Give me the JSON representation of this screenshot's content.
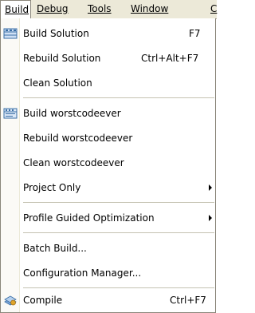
{
  "menubar": {
    "build": "Build",
    "debug": "Debug",
    "tools": "Tools",
    "window": "Window",
    "clipped": "C"
  },
  "menu": {
    "build_solution": {
      "label": "Build Solution",
      "shortcut": "F7"
    },
    "rebuild_solution": {
      "label": "Rebuild Solution",
      "shortcut": "Ctrl+Alt+F7"
    },
    "clean_solution": {
      "label": "Clean Solution"
    },
    "build_project": {
      "label": "Build worstcodeever"
    },
    "rebuild_project": {
      "label": "Rebuild worstcodeever"
    },
    "clean_project": {
      "label": "Clean worstcodeever"
    },
    "project_only": {
      "label": "Project Only"
    },
    "pgo": {
      "label": "Profile Guided Optimization"
    },
    "batch_build": {
      "label": "Batch Build..."
    },
    "config_manager": {
      "label": "Configuration Manager..."
    },
    "compile": {
      "label": "Compile",
      "shortcut": "Ctrl+F7"
    }
  },
  "colors": {
    "menubar_bg": "#ece9d8",
    "menu_bg": "#ffffff",
    "gutter_bg": "#fbfaf6",
    "separator": "#c5c2b2",
    "icon_blue": "#3a6ea5"
  }
}
